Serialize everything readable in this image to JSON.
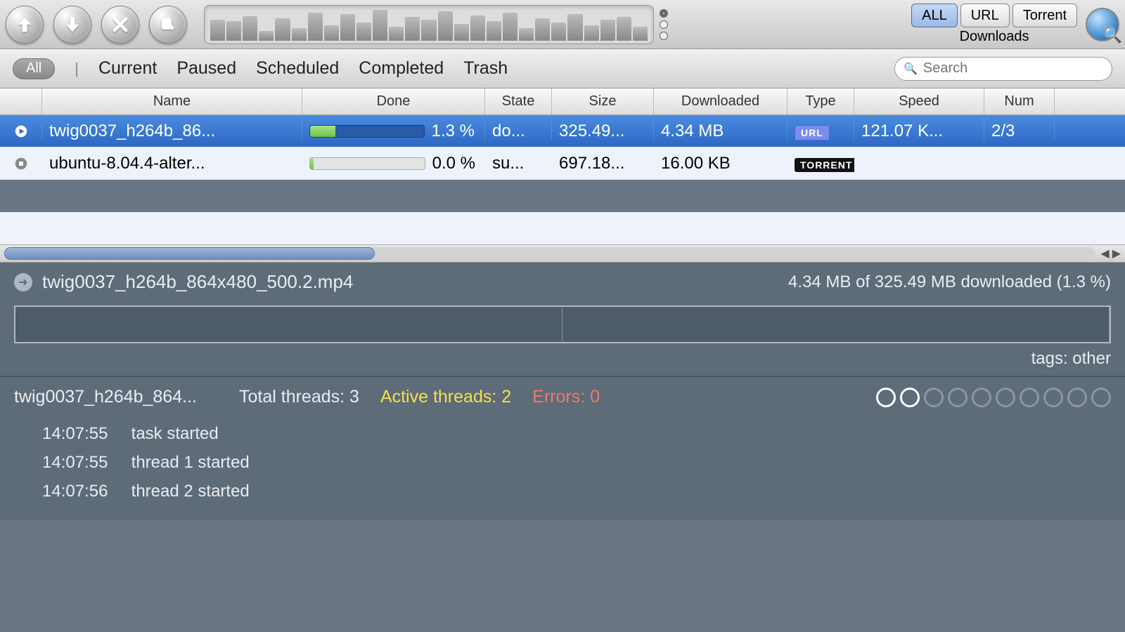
{
  "toolbar": {
    "downloads_label": "Downloads",
    "mode_tabs": {
      "all": "ALL",
      "url": "URL",
      "torrent": "Torrent"
    }
  },
  "filter": {
    "all": "All",
    "current": "Current",
    "paused": "Paused",
    "scheduled": "Scheduled",
    "completed": "Completed",
    "trash": "Trash",
    "search_placeholder": "Search"
  },
  "columns": {
    "name": "Name",
    "done": "Done",
    "state": "State",
    "size": "Size",
    "downloaded": "Downloaded",
    "type": "Type",
    "speed": "Speed",
    "num": "Num"
  },
  "rows": [
    {
      "name": "twig0037_h264b_86...",
      "done_pct": "1.3 %",
      "done_fill": 22,
      "state": "do...",
      "size": "325.49...",
      "downloaded": "4.34 MB",
      "type": "URL",
      "speed": "121.07 K...",
      "num": "2/3",
      "selected": true,
      "icon": "play"
    },
    {
      "name": "ubuntu-8.04.4-alter...",
      "done_pct": "0.0 %",
      "done_fill": 3,
      "state": "su...",
      "size": "697.18...",
      "downloaded": "16.00 KB",
      "type": "TORRENT",
      "speed": "",
      "num": "",
      "selected": false,
      "icon": "stop"
    }
  ],
  "detail": {
    "filename": "twig0037_h264b_864x480_500.2.mp4",
    "progress_text": "4.34 MB of 325.49 MB downloaded (1.3 %)",
    "tags_text": "tags: other"
  },
  "threads": {
    "name": "twig0037_h264b_864...",
    "total_label": "Total threads: 3",
    "active_label": "Active threads: 2",
    "errors_label": "Errors: 0",
    "circles_total": 10,
    "circles_on": 2
  },
  "log": [
    {
      "time": "14:07:55",
      "msg": "task started"
    },
    {
      "time": "14:07:55",
      "msg": "thread 1 started"
    },
    {
      "time": "14:07:56",
      "msg": "thread 2 started"
    }
  ],
  "meter_heights": [
    30,
    28,
    35,
    14,
    32,
    18,
    40,
    22,
    38,
    26,
    44,
    20,
    34,
    30,
    42,
    24,
    36,
    28,
    40,
    18,
    32,
    26,
    38,
    22,
    30,
    34,
    20
  ],
  "chunks": [
    50,
    50
  ]
}
